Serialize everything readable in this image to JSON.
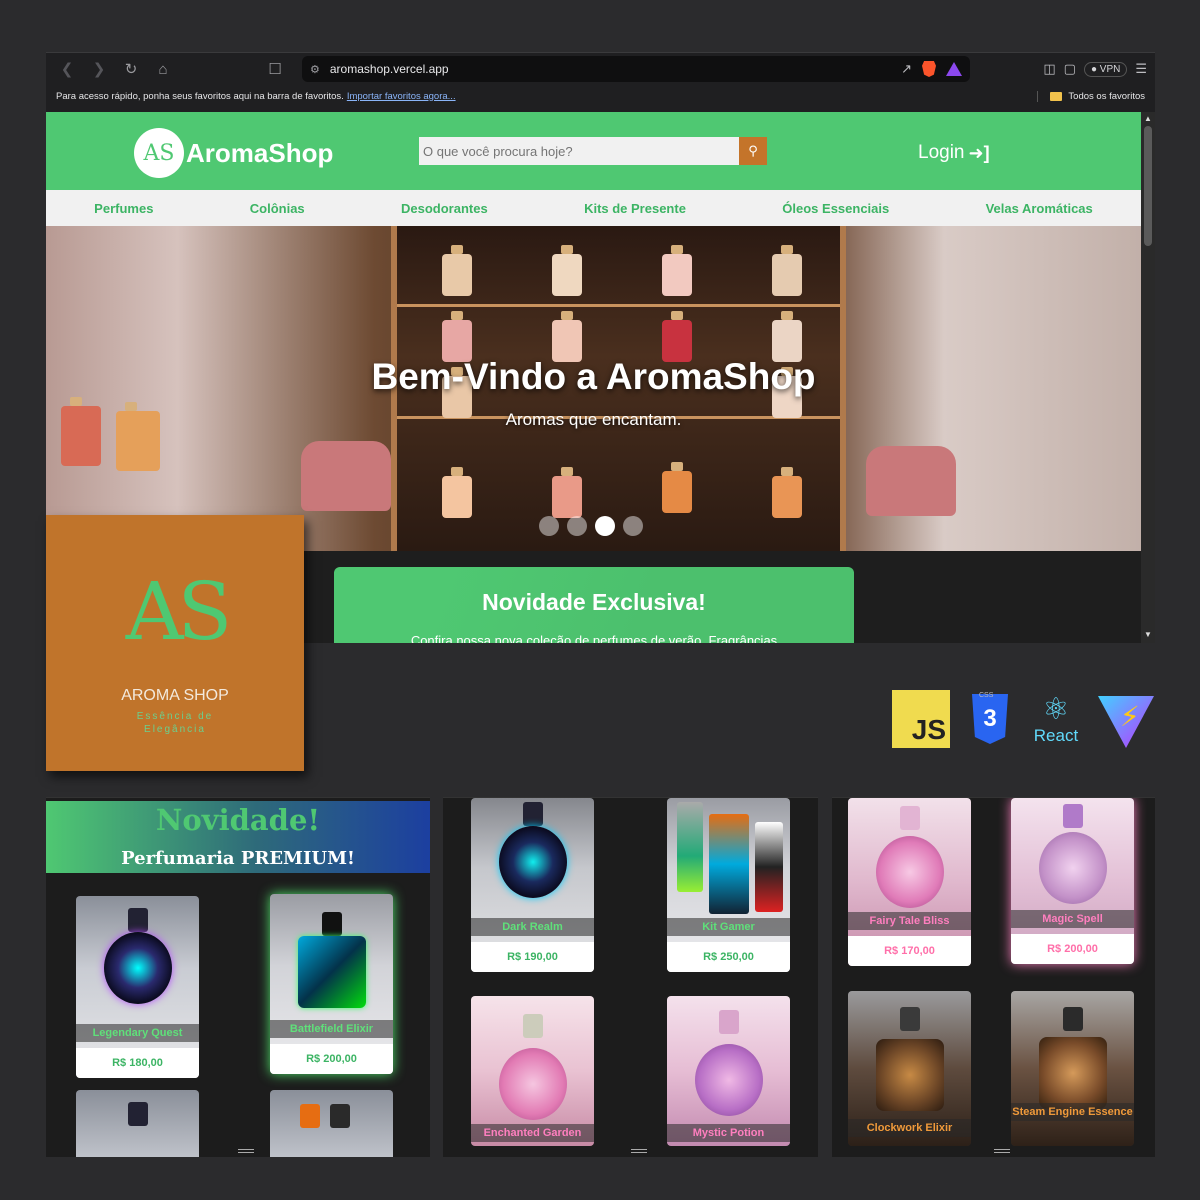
{
  "browser": {
    "url": "aromashop.vercel.app",
    "favorites_hint": "Para acesso rápido, ponha seus favoritos aqui na barra de favoritos.",
    "favorites_import_link": "Importar favoritos agora...",
    "all_favorites": "Todos os favoritos",
    "vpn_label": "VPN"
  },
  "site": {
    "logo_mark": "AS",
    "brand": "AromaShop",
    "search_placeholder": "O que você procura hoje?",
    "login_label": "Login",
    "categories": [
      "Perfumes",
      "Colônias",
      "Desodorantes",
      "Kits de Presente",
      "Óleos Essenciais",
      "Velas Aromáticas"
    ],
    "hero_title": "Bem-Vindo a AromaShop",
    "hero_subtitle": "Aromas que encantam.",
    "carousel": {
      "slides": 4,
      "active_index": 2
    },
    "promo_title": "Novidade Exclusiva!",
    "promo_text": "Confira nossa nova coleção de perfumes de verão. Fragrâncias"
  },
  "logo_card": {
    "mark": "AS",
    "brand": "AROMA SHOP",
    "tagline_line1": "Essência de",
    "tagline_line2": "Elegância"
  },
  "tech_stack": [
    {
      "name": "JavaScript",
      "label": "JS"
    },
    {
      "name": "CSS3",
      "label": "3",
      "badge": "CSS"
    },
    {
      "name": "React",
      "label": "React"
    },
    {
      "name": "Vite",
      "label": "⚡"
    }
  ],
  "panel_gamer": {
    "banner_title": "Novidade!",
    "banner_subtitle": "Perfumaria PREMIUM!",
    "products": [
      {
        "name": "Legendary Quest",
        "price": "R$ 180,00"
      },
      {
        "name": "Battlefield Elixir",
        "price": "R$ 200,00"
      }
    ]
  },
  "panel_mixed": {
    "products": [
      {
        "name": "Dark Realm",
        "price": "R$ 190,00"
      },
      {
        "name": "Kit Gamer",
        "price": "R$ 250,00"
      },
      {
        "name": "Enchanted Garden"
      },
      {
        "name": "Mystic Potion"
      }
    ]
  },
  "panel_fantasy": {
    "products": [
      {
        "name": "Fairy Tale Bliss",
        "price": "R$ 170,00"
      },
      {
        "name": "Magic Spell",
        "price": "R$ 200,00"
      },
      {
        "name": "Clockwork Elixir"
      },
      {
        "name": "Steam Engine Essence"
      }
    ]
  },
  "colors": {
    "brand_green": "#4fc872",
    "accent_orange": "#c4742a",
    "background": "#2b2b2d"
  }
}
